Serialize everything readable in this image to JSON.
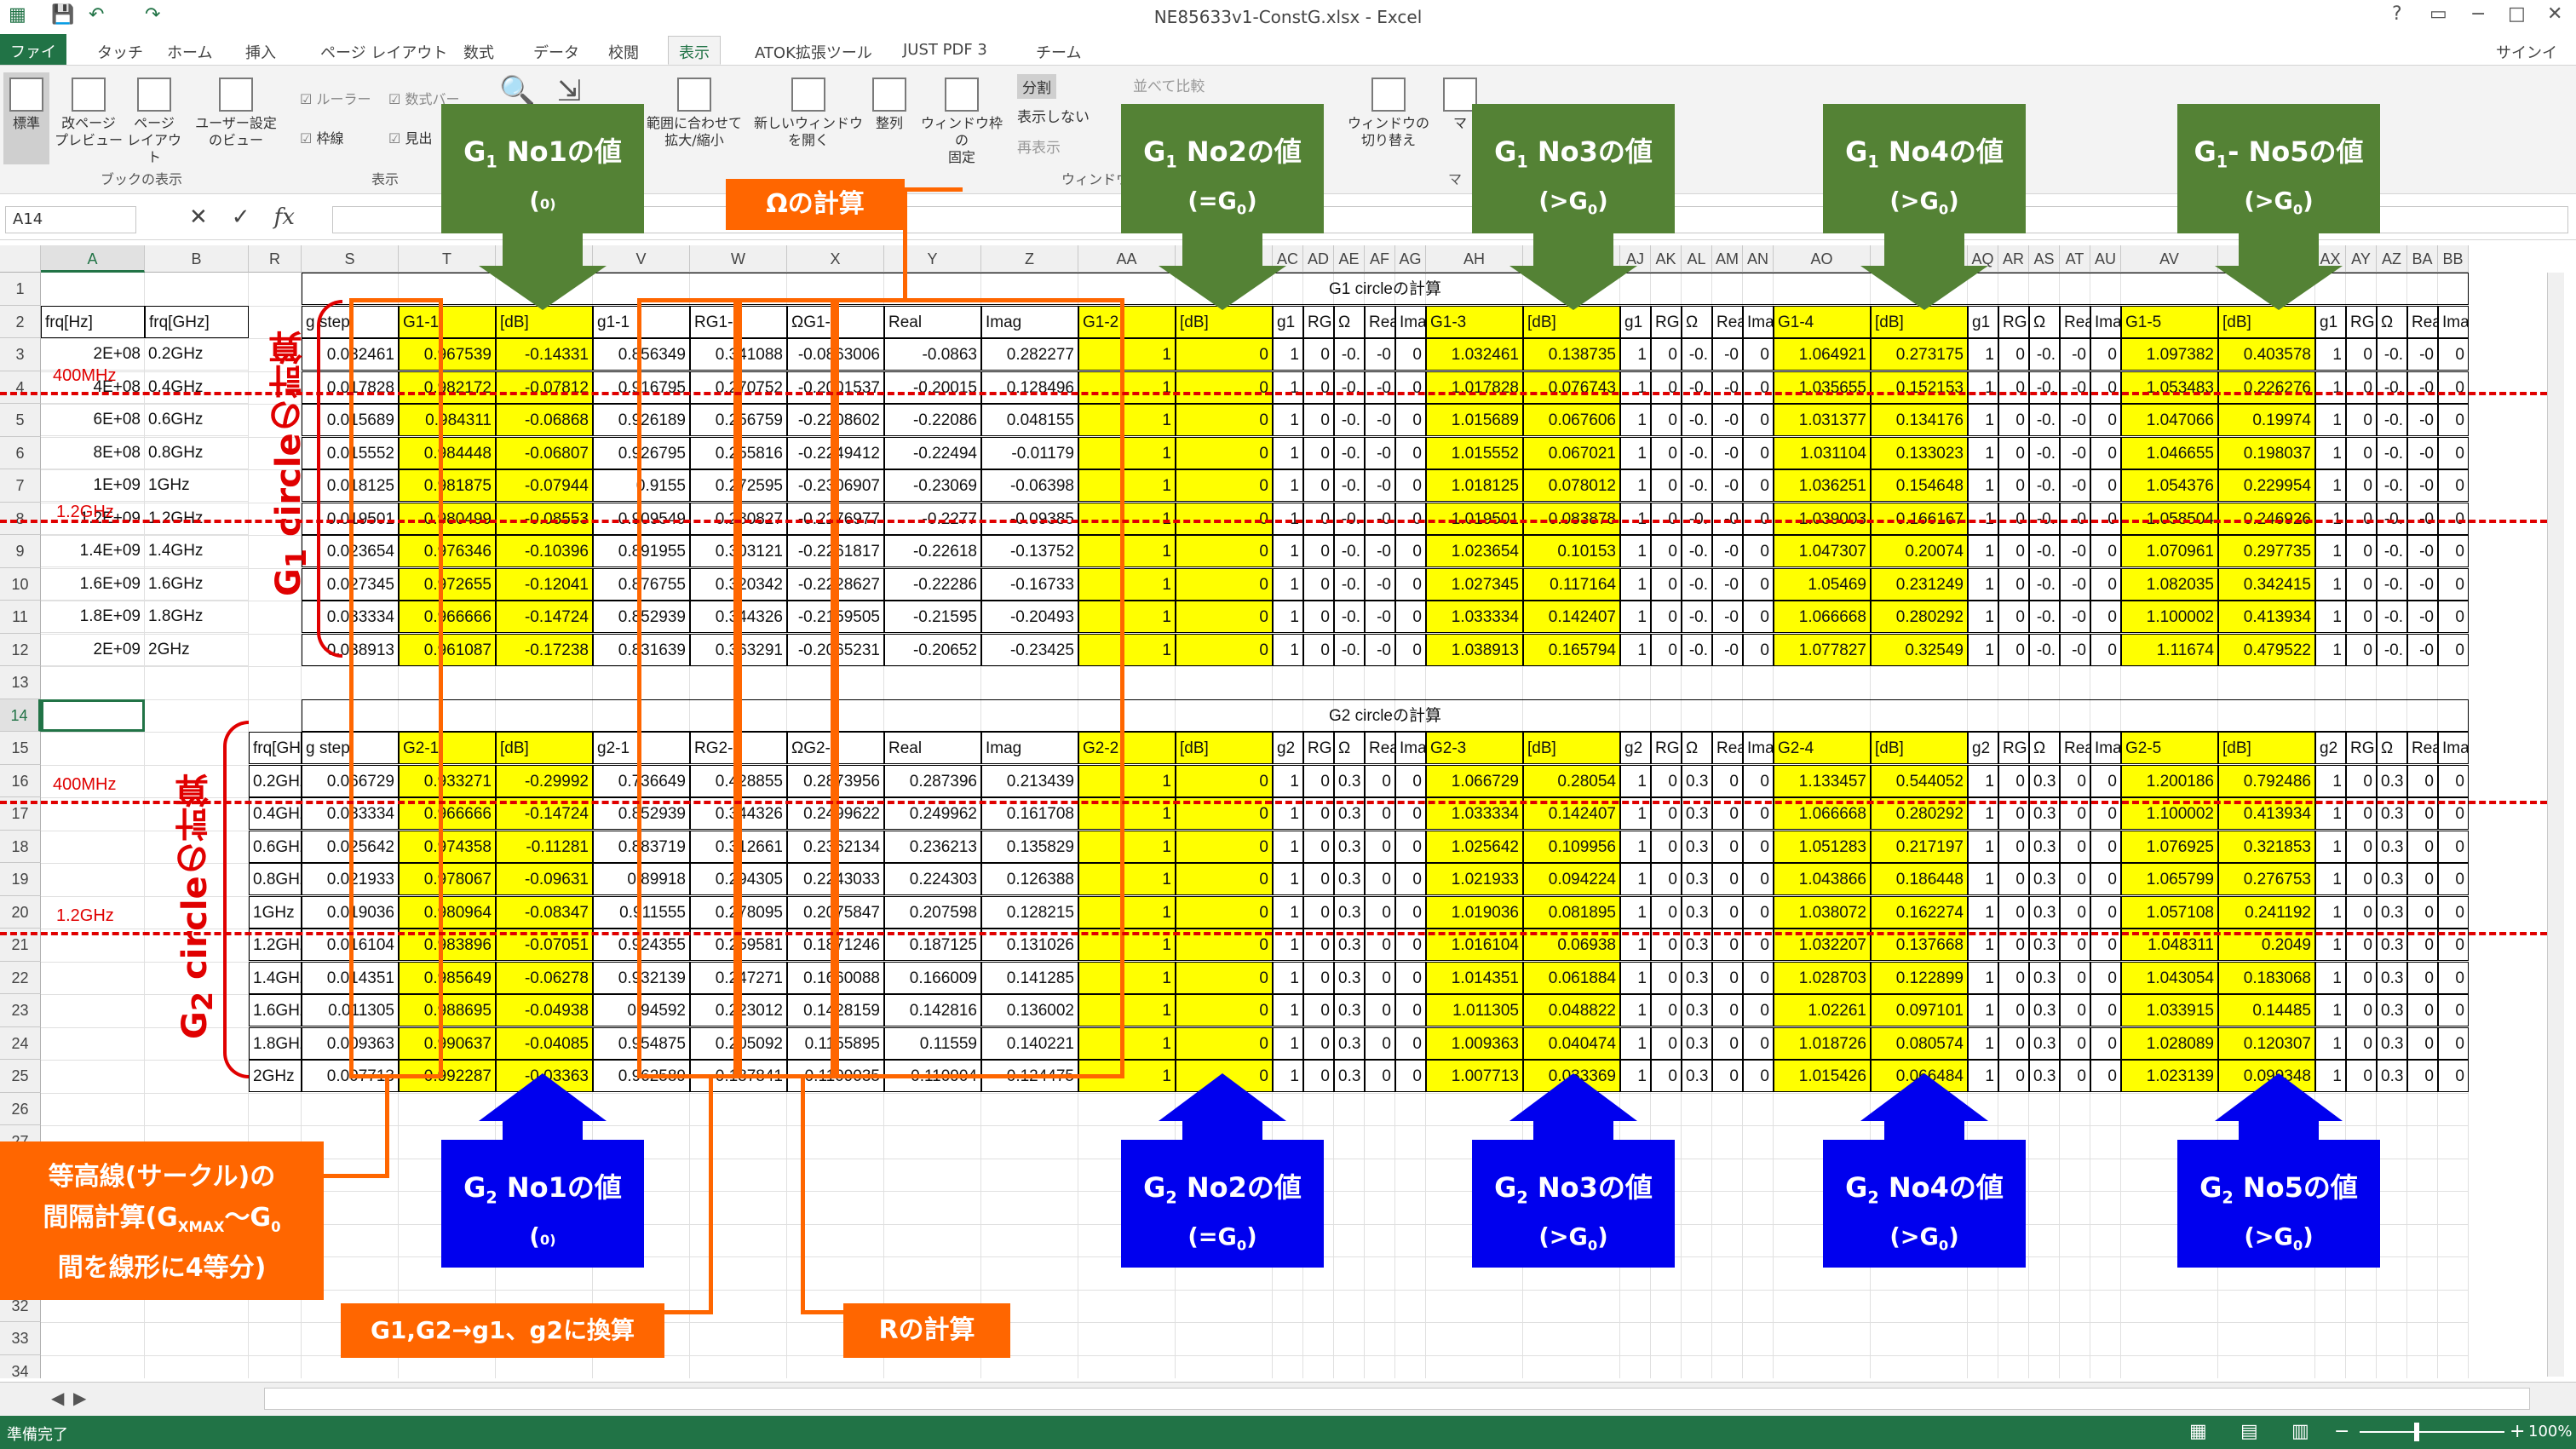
{
  "window": {
    "title": "NE85633v1-ConstG.xlsx - Excel",
    "signin": "サインイン",
    "controls": [
      "?",
      "▭",
      "−",
      "□",
      "✕"
    ]
  },
  "tabs": [
    "ファイル",
    "タッチ",
    "ホーム",
    "挿入",
    "ページ レイアウト",
    "数式",
    "データ",
    "校閲",
    "表示",
    "ATOK拡張ツール",
    "JUST PDF 3",
    "チーム"
  ],
  "ribbon": {
    "buttons": [
      {
        "label": "標準"
      },
      {
        "label": "改ページ\nプレビュー"
      },
      {
        "label": "ページ\nレイアウト"
      },
      {
        "label": "ユーザー設定\nのビュー"
      },
      {
        "label": "範囲に合わせて\n拡大/縮小"
      },
      {
        "label": "新しいウィンドウ\nを開く"
      },
      {
        "label": "整列"
      },
      {
        "label": "ウィンドウ枠の\n固定"
      },
      {
        "label": "ウィンドウの\n切り替え"
      },
      {
        "label": "マ"
      }
    ],
    "checks": [
      "ルーラー",
      "数式バー",
      "枠線",
      "見出"
    ],
    "window_items": [
      "分割",
      "表示しない",
      "再表示",
      "並べて比較"
    ],
    "groups": [
      "ブックの表示",
      "表示",
      "ウィンドウ",
      "マ"
    ]
  },
  "formula": {
    "name_box": "A14",
    "fx": "fx",
    "value": ""
  },
  "sheet": {
    "selected_row": "14",
    "columns": [
      {
        "id": "A",
        "w": 122
      },
      {
        "id": "B",
        "w": 122
      },
      {
        "id": "R",
        "w": 62
      },
      {
        "id": "S",
        "w": 114
      },
      {
        "id": "T",
        "w": 114
      },
      {
        "id": "U",
        "w": 114
      },
      {
        "id": "V",
        "w": 114
      },
      {
        "id": "W",
        "w": 114
      },
      {
        "id": "X",
        "w": 114
      },
      {
        "id": "Y",
        "w": 114
      },
      {
        "id": "Z",
        "w": 114
      },
      {
        "id": "AA",
        "w": 114
      },
      {
        "id": "AB",
        "w": 114
      },
      {
        "id": "AC",
        "w": 36
      },
      {
        "id": "AD",
        "w": 36
      },
      {
        "id": "AE",
        "w": 36
      },
      {
        "id": "AF",
        "w": 36
      },
      {
        "id": "AG",
        "w": 36
      },
      {
        "id": "AH",
        "w": 114
      },
      {
        "id": "AI",
        "w": 114
      },
      {
        "id": "AJ",
        "w": 36
      },
      {
        "id": "AK",
        "w": 36
      },
      {
        "id": "AL",
        "w": 36
      },
      {
        "id": "AM",
        "w": 36
      },
      {
        "id": "AN",
        "w": 36
      },
      {
        "id": "AO",
        "w": 114
      },
      {
        "id": "AP",
        "w": 114
      },
      {
        "id": "AQ",
        "w": 36
      },
      {
        "id": "AR",
        "w": 36
      },
      {
        "id": "AS",
        "w": 36
      },
      {
        "id": "AT",
        "w": 36
      },
      {
        "id": "AU",
        "w": 36
      },
      {
        "id": "AV",
        "w": 114
      },
      {
        "id": "AW",
        "w": 114
      },
      {
        "id": "AX",
        "w": 36
      },
      {
        "id": "AY",
        "w": 36
      },
      {
        "id": "AZ",
        "w": 36
      },
      {
        "id": "BA",
        "w": 36
      },
      {
        "id": "BB",
        "w": 36
      }
    ],
    "rows": [
      "1",
      "2",
      "3",
      "4",
      "5",
      "6",
      "7",
      "8",
      "9",
      "10",
      "11",
      "12",
      "13",
      "14",
      "15",
      "16",
      "17",
      "18",
      "19",
      "20",
      "21",
      "22",
      "23",
      "24",
      "25",
      "26",
      "27",
      "28",
      "29",
      "30",
      "31",
      "32",
      "33",
      "34",
      "35",
      "36",
      "37"
    ],
    "titles": {
      "g1": "G1 circleの計算",
      "g2": "G2 circleの計算"
    },
    "g1_headers": {
      "A": "frq[Hz]",
      "B": "frq[GHz]",
      "S": "g step",
      "T": "G1-1",
      "U": "[dB]",
      "V": "g1-1",
      "W": "RG1-1",
      "X": "ΩG1-1",
      "Y": "Real",
      "Z": "Imag",
      "AA": "G1-2",
      "AB": "[dB]",
      "AH": "G1-3",
      "AI": "[dB]",
      "AO": "G1-4",
      "AP": "[dB]",
      "AV": "G1-5",
      "AW": "[dB]"
    },
    "g1_rows": [
      {
        "A": "2E+08",
        "B": "0.2GHz",
        "S": "0.032461",
        "T": "0.967539",
        "U": "-0.14331",
        "V": "0.856349",
        "W": "0.341088",
        "X": "-0.0863006",
        "Y": "-0.0863",
        "Z": "0.282277",
        "AA": "1",
        "AB": "0",
        "AH": "1.032461",
        "AI": "0.138735",
        "AO": "1.064921",
        "AP": "0.273175",
        "AV": "1.097382",
        "AW": "0.403578"
      },
      {
        "A": "4E+08",
        "B": "0.4GHz",
        "S": "0.017828",
        "T": "0.982172",
        "U": "-0.07812",
        "V": "0.916795",
        "W": "0.270752",
        "X": "-0.2001537",
        "Y": "-0.20015",
        "Z": "0.128496",
        "AA": "1",
        "AB": "0",
        "AH": "1.017828",
        "AI": "0.076743",
        "AO": "1.035655",
        "AP": "0.152153",
        "AV": "1.053483",
        "AW": "0.226276"
      },
      {
        "A": "6E+08",
        "B": "0.6GHz",
        "S": "0.015689",
        "T": "0.984311",
        "U": "-0.06868",
        "V": "0.926189",
        "W": "0.256759",
        "X": "-0.2208602",
        "Y": "-0.22086",
        "Z": "0.048155",
        "AA": "1",
        "AB": "0",
        "AH": "1.015689",
        "AI": "0.067606",
        "AO": "1.031377",
        "AP": "0.134176",
        "AV": "1.047066",
        "AW": "0.19974"
      },
      {
        "A": "8E+08",
        "B": "0.8GHz",
        "S": "0.015552",
        "T": "0.984448",
        "U": "-0.06807",
        "V": "0.926795",
        "W": "0.255816",
        "X": "-0.2249412",
        "Y": "-0.22494",
        "Z": "-0.01179",
        "AA": "1",
        "AB": "0",
        "AH": "1.015552",
        "AI": "0.067021",
        "AO": "1.031104",
        "AP": "0.133023",
        "AV": "1.046655",
        "AW": "0.198037"
      },
      {
        "A": "1E+09",
        "B": "1GHz",
        "S": "0.018125",
        "T": "0.981875",
        "U": "-0.07944",
        "V": "0.9155",
        "W": "0.272595",
        "X": "-0.2306907",
        "Y": "-0.23069",
        "Z": "-0.06398",
        "AA": "1",
        "AB": "0",
        "AH": "1.018125",
        "AI": "0.078012",
        "AO": "1.036251",
        "AP": "0.154648",
        "AV": "1.054376",
        "AW": "0.229954"
      },
      {
        "A": "1.2E+09",
        "B": "1.2GHz",
        "S": "0.019501",
        "T": "0.980499",
        "U": "-0.08553",
        "V": "0.909549",
        "W": "0.280827",
        "X": "-0.2276977",
        "Y": "-0.2277",
        "Z": "-0.09385",
        "AA": "1",
        "AB": "0",
        "AH": "1.019501",
        "AI": "0.083878",
        "AO": "1.039003",
        "AP": "0.166167",
        "AV": "1.058504",
        "AW": "0.246926"
      },
      {
        "A": "1.4E+09",
        "B": "1.4GHz",
        "S": "0.023654",
        "T": "0.976346",
        "U": "-0.10396",
        "V": "0.891955",
        "W": "0.303121",
        "X": "-0.2261817",
        "Y": "-0.22618",
        "Z": "-0.13752",
        "AA": "1",
        "AB": "0",
        "AH": "1.023654",
        "AI": "0.10153",
        "AO": "1.047307",
        "AP": "0.20074",
        "AV": "1.070961",
        "AW": "0.297735"
      },
      {
        "A": "1.6E+09",
        "B": "1.6GHz",
        "S": "0.027345",
        "T": "0.972655",
        "U": "-0.12041",
        "V": "0.876755",
        "W": "0.320342",
        "X": "-0.2228627",
        "Y": "-0.22286",
        "Z": "-0.16733",
        "AA": "1",
        "AB": "0",
        "AH": "1.027345",
        "AI": "0.117164",
        "AO": "1.05469",
        "AP": "0.231249",
        "AV": "1.082035",
        "AW": "0.342415"
      },
      {
        "A": "1.8E+09",
        "B": "1.8GHz",
        "S": "0.033334",
        "T": "0.966666",
        "U": "-0.14724",
        "V": "0.852939",
        "W": "0.344326",
        "X": "-0.2159505",
        "Y": "-0.21595",
        "Z": "-0.20493",
        "AA": "1",
        "AB": "0",
        "AH": "1.033334",
        "AI": "0.142407",
        "AO": "1.066668",
        "AP": "0.280292",
        "AV": "1.100002",
        "AW": "0.413934"
      },
      {
        "A": "2E+09",
        "B": "2GHz",
        "S": "0.038913",
        "T": "0.961087",
        "U": "-0.17238",
        "V": "0.831639",
        "W": "0.363291",
        "X": "-0.2065231",
        "Y": "-0.20652",
        "Z": "-0.23425",
        "AA": "1",
        "AB": "0",
        "AH": "1.038913",
        "AI": "0.165794",
        "AO": "1.077827",
        "AP": "0.32549",
        "AV": "1.11674",
        "AW": "0.479522"
      }
    ],
    "g2_headers": {
      "R": "frq[GHz]",
      "S": "g step",
      "T": "G2-1",
      "U": "[dB]",
      "V": "g2-1",
      "W": "RG2-1",
      "X": "ΩG2-1",
      "Y": "Real",
      "Z": "Imag",
      "AA": "G2-2",
      "AB": "[dB]",
      "AH": "G2-3",
      "AI": "[dB]",
      "AO": "G2-4",
      "AP": "[dB]",
      "AV": "G2-5",
      "AW": "[dB]"
    },
    "g2_rows": [
      {
        "R": "0.2GHz",
        "S": "0.066729",
        "T": "0.933271",
        "U": "-0.29992",
        "V": "0.736649",
        "W": "0.428855",
        "X": "0.2873956",
        "Y": "0.287396",
        "Z": "0.213439",
        "AA": "1",
        "AB": "0",
        "AH": "1.066729",
        "AI": "0.28054",
        "AO": "1.133457",
        "AP": "0.544052",
        "AV": "1.200186",
        "AW": "0.792486"
      },
      {
        "R": "0.4GHz",
        "S": "0.033334",
        "T": "0.966666",
        "U": "-0.14724",
        "V": "0.852939",
        "W": "0.344326",
        "X": "0.2499622",
        "Y": "0.249962",
        "Z": "0.161708",
        "AA": "1",
        "AB": "0",
        "AH": "1.033334",
        "AI": "0.142407",
        "AO": "1.066668",
        "AP": "0.280292",
        "AV": "1.100002",
        "AW": "0.413934"
      },
      {
        "R": "0.6GHz",
        "S": "0.025642",
        "T": "0.974358",
        "U": "-0.11281",
        "V": "0.883719",
        "W": "0.312661",
        "X": "0.2362134",
        "Y": "0.236213",
        "Z": "0.135829",
        "AA": "1",
        "AB": "0",
        "AH": "1.025642",
        "AI": "0.109956",
        "AO": "1.051283",
        "AP": "0.217197",
        "AV": "1.076925",
        "AW": "0.321853"
      },
      {
        "R": "0.8GHz",
        "S": "0.021933",
        "T": "0.978067",
        "U": "-0.09631",
        "V": "0.89918",
        "W": "0.294305",
        "X": "0.2243033",
        "Y": "0.224303",
        "Z": "0.126388",
        "AA": "1",
        "AB": "0",
        "AH": "1.021933",
        "AI": "0.094224",
        "AO": "1.043866",
        "AP": "0.186448",
        "AV": "1.065799",
        "AW": "0.276753"
      },
      {
        "R": "1GHz",
        "S": "0.019036",
        "T": "0.980964",
        "U": "-0.08347",
        "V": "0.911555",
        "W": "0.278095",
        "X": "0.2075847",
        "Y": "0.207598",
        "Z": "0.128215",
        "AA": "1",
        "AB": "0",
        "AH": "1.019036",
        "AI": "0.081895",
        "AO": "1.038072",
        "AP": "0.162274",
        "AV": "1.057108",
        "AW": "0.241192"
      },
      {
        "R": "1.2GHz",
        "S": "0.016104",
        "T": "0.983896",
        "U": "-0.07051",
        "V": "0.924355",
        "W": "0.259581",
        "X": "0.1871246",
        "Y": "0.187125",
        "Z": "0.131026",
        "AA": "1",
        "AB": "0",
        "AH": "1.016104",
        "AI": "0.06938",
        "AO": "1.032207",
        "AP": "0.137668",
        "AV": "1.048311",
        "AW": "0.2049"
      },
      {
        "R": "1.4GHz",
        "S": "0.014351",
        "T": "0.985649",
        "U": "-0.06278",
        "V": "0.932139",
        "W": "0.247271",
        "X": "0.1660088",
        "Y": "0.166009",
        "Z": "0.141285",
        "AA": "1",
        "AB": "0",
        "AH": "1.014351",
        "AI": "0.061884",
        "AO": "1.028703",
        "AP": "0.122899",
        "AV": "1.043054",
        "AW": "0.183068"
      },
      {
        "R": "1.6GHz",
        "S": "0.011305",
        "T": "0.988695",
        "U": "-0.04938",
        "V": "0.94592",
        "W": "0.223012",
        "X": "0.1428159",
        "Y": "0.142816",
        "Z": "0.136002",
        "AA": "1",
        "AB": "0",
        "AH": "1.011305",
        "AI": "0.048822",
        "AO": "1.02261",
        "AP": "0.097101",
        "AV": "1.033915",
        "AW": "0.14485"
      },
      {
        "R": "1.8GHz",
        "S": "0.009363",
        "T": "0.990637",
        "U": "-0.04085",
        "V": "0.954875",
        "W": "0.205092",
        "X": "0.1155895",
        "Y": "0.11559",
        "Z": "0.140221",
        "AA": "1",
        "AB": "0",
        "AH": "1.009363",
        "AI": "0.040474",
        "AO": "1.018726",
        "AP": "0.080574",
        "AV": "1.028089",
        "AW": "0.120307"
      },
      {
        "R": "2GHz",
        "S": "0.007713",
        "T": "0.992287",
        "U": "-0.03363",
        "V": "0.962589",
        "W": "0.187841",
        "X": "0.1109035",
        "Y": "0.110904",
        "Z": "0.124475",
        "AA": "1",
        "AB": "0",
        "AH": "1.007713",
        "AI": "0.033369",
        "AO": "1.015426",
        "AP": "0.066484",
        "AV": "1.023139",
        "AW": "0.099348"
      }
    ],
    "small_g1_headers": [
      "g1",
      "RG",
      "Ω",
      "Rea",
      "Ima"
    ],
    "small_g2_headers": [
      "g2",
      "RG",
      "Ω",
      "Rea",
      "Ima"
    ],
    "small_g1_values": [
      "1",
      "0",
      "-0.",
      "-0",
      "0"
    ],
    "small_g2_values": [
      "1",
      "0",
      "0.3",
      "0",
      "0"
    ]
  },
  "annotations": {
    "green": [
      {
        "main": "G",
        "sub": "1",
        "rest": " No1の値",
        "line2": "(<G",
        "sub2": "0",
        "end": ")"
      },
      {
        "main": "G",
        "sub": "1",
        "rest": " No2の値",
        "line2": "(=G",
        "sub2": "0",
        "end": ")"
      },
      {
        "main": "G",
        "sub": "1",
        "rest": " No3の値",
        "line2": "(>G",
        "sub2": "0",
        "end": ")"
      },
      {
        "main": "G",
        "sub": "1",
        "rest": " No4の値",
        "line2": "(>G",
        "sub2": "0",
        "end": ")"
      },
      {
        "main": "G",
        "sub": "1",
        "rest": "- No5の値",
        "line2": "(>G",
        "sub2": "0",
        "end": ")"
      }
    ],
    "blue": [
      {
        "main": "G",
        "sub": "2",
        "rest": " No1の値",
        "line2": "(<G",
        "sub2": "0",
        "end": ")"
      },
      {
        "main": "G",
        "sub": "2",
        "rest": " No2の値",
        "line2": "(=G",
        "sub2": "0",
        "end": ")"
      },
      {
        "main": "G",
        "sub": "2",
        "rest": " No3の値",
        "line2": "(>G",
        "sub2": "0",
        "end": ")"
      },
      {
        "main": "G",
        "sub": "2",
        "rest": " No4の値",
        "line2": "(>G",
        "sub2": "0",
        "end": ")"
      },
      {
        "main": "G",
        "sub": "2",
        "rest": " No5の値",
        "line2": "(>G",
        "sub2": "0",
        "end": ")"
      }
    ],
    "omega": "Ωの計算",
    "r_calc": "Rの計算",
    "g_conv": "G1,G2→g1、g2に換算",
    "interval_1": "等高線(サークル)の",
    "interval_2a": "間隔計算(G",
    "interval_2sub": "XMAX",
    "interval_2b": "〜G",
    "interval_2sub2": "0",
    "interval_3": "間を線形に4等分)",
    "vertical_g1a": "G",
    "vertical_g1sub": "1",
    "vertical_g1b": " circleの計算",
    "vertical_g2a": "G",
    "vertical_g2sub": "2",
    "vertical_g2b": " circleの計算",
    "marker_400": "400MHz",
    "marker_12": "1.2GHz"
  },
  "status": {
    "ready": "準備完了",
    "zoom": "100%"
  }
}
